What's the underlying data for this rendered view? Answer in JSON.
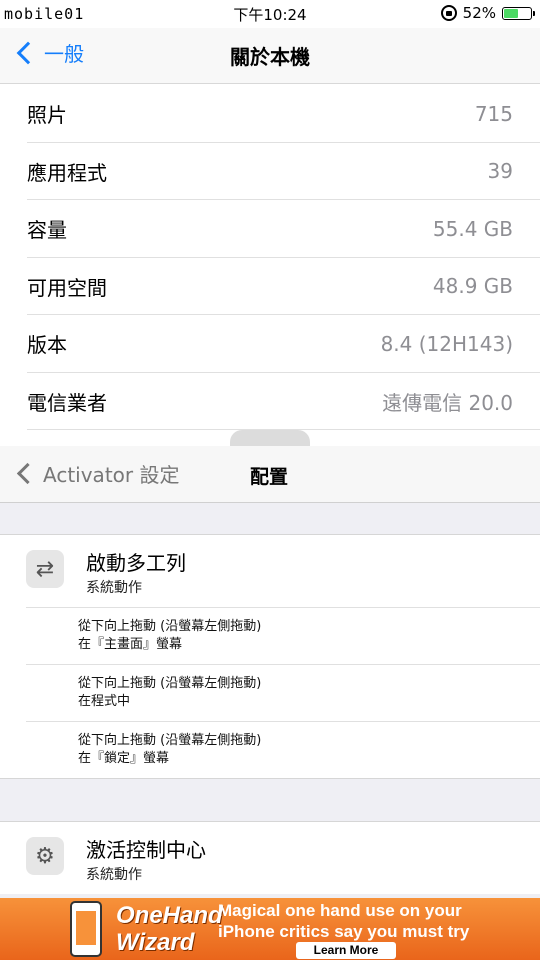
{
  "status_bar": {
    "carrier": "mobile01",
    "time": "下午10:24",
    "battery_percent_label": "52%",
    "battery_level": 0.52
  },
  "nav1": {
    "back_label": "一般",
    "title": "關於本機"
  },
  "about_rows": [
    {
      "label": "照片",
      "value": "715"
    },
    {
      "label": "應用程式",
      "value": "39"
    },
    {
      "label": "容量",
      "value": "55.4 GB"
    },
    {
      "label": "可用空間",
      "value": "48.9 GB"
    },
    {
      "label": "版本",
      "value": "8.4 (12H143)"
    },
    {
      "label": "電信業者",
      "value": "遠傳電信 20.0"
    }
  ],
  "activator": {
    "back_label": "Activator 設定",
    "title": "配置",
    "actions": [
      {
        "title": "啟動多工列",
        "subtitle": "系統動作",
        "icon": "swap-arrows-icon",
        "events": [
          {
            "line1": "從下向上拖動 (沿螢幕左側拖動)",
            "line2": "在『主畫面』螢幕"
          },
          {
            "line1": "從下向上拖動 (沿螢幕左側拖動)",
            "line2": "在程式中"
          },
          {
            "line1": "從下向上拖動 (沿螢幕左側拖動)",
            "line2": "在『鎖定』螢幕"
          }
        ]
      },
      {
        "title": "激活控制中心",
        "subtitle": "系統動作",
        "icon": "gear-icon"
      }
    ]
  },
  "ad": {
    "title_line1": "OneHand",
    "title_line2": "Wizard",
    "copy_line1": "Magical one hand use on your",
    "copy_line2": "iPhone critics say you must try",
    "button": "Learn More"
  },
  "colors": {
    "ios_blue": "#157efb",
    "battery_green": "#4cd964",
    "ad_orange": "#f7923a"
  }
}
